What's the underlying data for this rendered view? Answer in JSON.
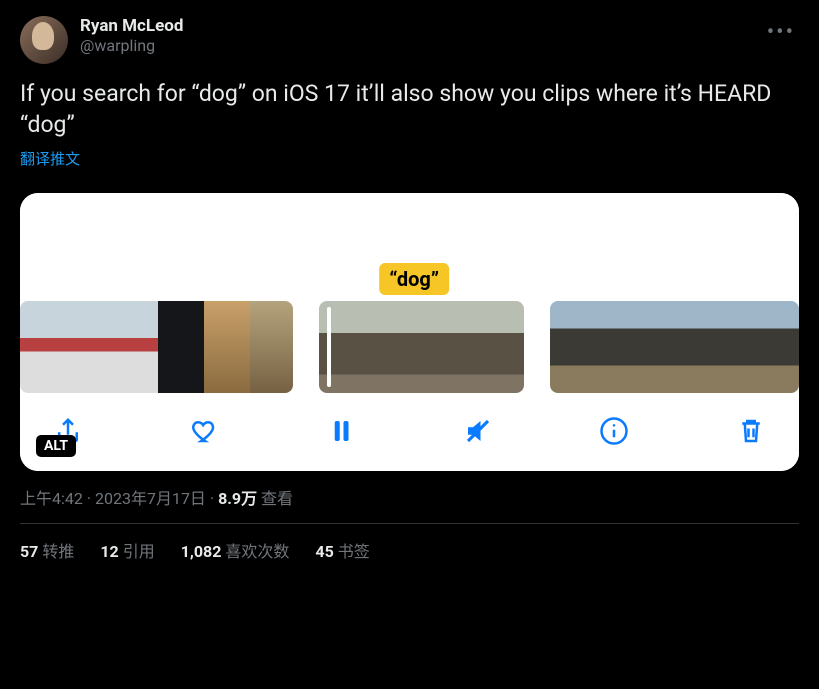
{
  "author": {
    "display_name": "Ryan McLeod",
    "handle": "@warpling"
  },
  "body": "If you search for “dog” on iOS 17 it’ll also show you clips where it’s HEARD “dog”",
  "translate_label": "翻译推文",
  "media": {
    "tag_text": "“dog”",
    "alt_badge": "ALT"
  },
  "meta": {
    "time": "上午4:42",
    "sep1": " · ",
    "date": "2023年7月17日",
    "sep2": " · ",
    "views_num": "8.9万",
    "views_label": " 查看"
  },
  "stats": {
    "retweets_num": "57",
    "retweets_label": "转推",
    "quotes_num": "12",
    "quotes_label": "引用",
    "likes_num": "1,082",
    "likes_label": "喜欢次数",
    "bookmarks_num": "45",
    "bookmarks_label": "书签"
  }
}
